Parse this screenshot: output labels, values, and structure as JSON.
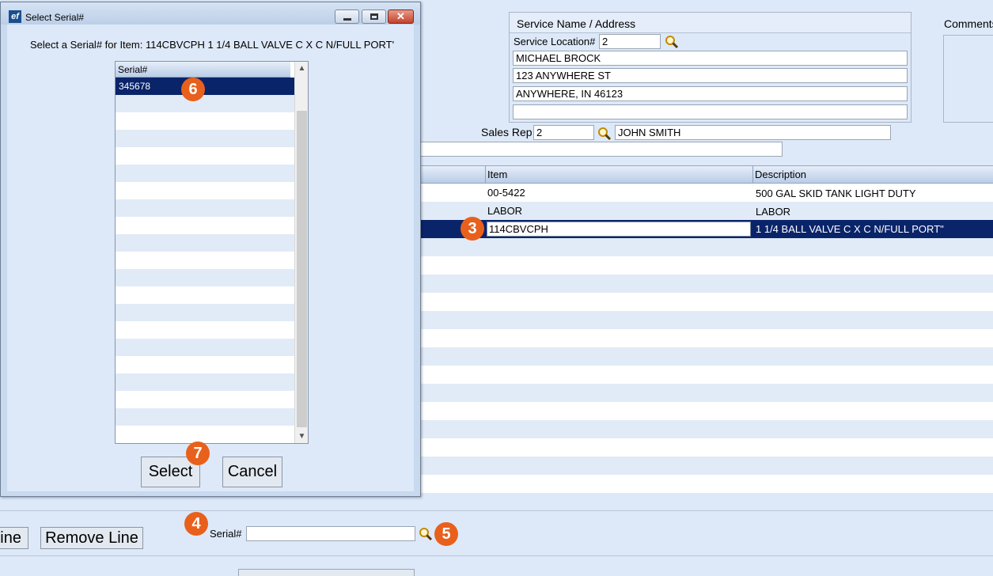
{
  "service_box": {
    "title": "Service Name / Address",
    "location_label": "Service Location#",
    "location_value": "2",
    "address_lines": [
      "MICHAEL BROCK",
      "123 ANYWHERE ST",
      "ANYWHERE, IN  46123",
      ""
    ]
  },
  "comments_label": "Comments",
  "sales_rep": {
    "label": "Sales Rep",
    "code": "2",
    "name": "JOHN SMITH"
  },
  "lines_grid": {
    "columns": [
      "Item",
      "Description"
    ],
    "rows": [
      {
        "item": "00-5422",
        "description": "500 GAL SKID TANK LIGHT DUTY"
      },
      {
        "item": "LABOR",
        "description": "LABOR"
      },
      {
        "item": "114CBVCPH",
        "description": "1 1/4 BALL VALVE C X C N/FULL PORT\""
      }
    ],
    "selected_row": 2
  },
  "bottom_bar": {
    "add_line_label": "ine",
    "remove_line_label": "Remove Line",
    "serial_label": "Serial#",
    "serial_value": ""
  },
  "dialog": {
    "title": "Select Serial#",
    "prompt": "Select a Serial# for Item: 114CBVCPH 1 1/4 BALL VALVE C X C N/FULL PORT'",
    "list_header": "Serial#",
    "serials": [
      "345678"
    ],
    "select_label": "Select",
    "cancel_label": "Cancel"
  },
  "annotations": [
    "3",
    "4",
    "5",
    "6",
    "7"
  ],
  "colors": {
    "background": "#dde9f8",
    "selection": "#0a246a",
    "badge": "#e8601c",
    "title_bar": "#c4d5ec"
  }
}
